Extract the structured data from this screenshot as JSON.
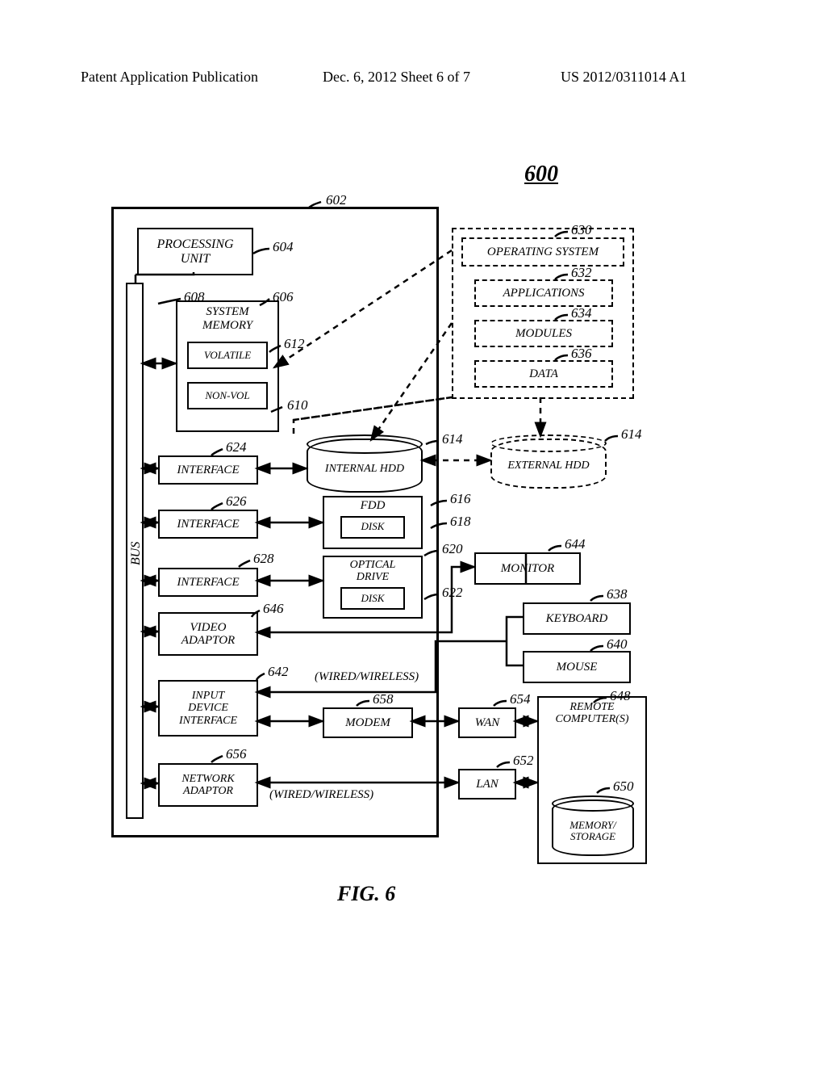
{
  "header": {
    "left": "Patent Application Publication",
    "mid": "Dec. 6, 2012   Sheet 6 of 7",
    "right": "US 2012/0311014 A1"
  },
  "figure": {
    "number_label": "600",
    "caption": "FIG. 6"
  },
  "boxes": {
    "processing_unit": "PROCESSING\nUNIT",
    "system_memory": "SYSTEM\nMEMORY",
    "volatile": "VOLATILE",
    "nonvol": "NON-VOL",
    "interface1": "INTERFACE",
    "interface2": "INTERFACE",
    "interface3": "INTERFACE",
    "video_adaptor": "VIDEO\nADAPTOR",
    "input_device_interface": "INPUT\nDEVICE\nINTERFACE",
    "network_adaptor": "NETWORK\nADAPTOR",
    "internal_hdd": "INTERNAL HDD",
    "external_hdd": "EXTERNAL HDD",
    "fdd": "FDD",
    "fdd_disk": "DISK",
    "optical_drive": "OPTICAL\nDRIVE",
    "optical_disk": "DISK",
    "monitor": "MONITOR",
    "keyboard": "KEYBOARD",
    "mouse": "MOUSE",
    "modem": "MODEM",
    "wan": "WAN",
    "lan": "LAN",
    "remote_computers": "REMOTE\nCOMPUTER(S)",
    "memory_storage": "MEMORY/\nSTORAGE",
    "operating_system": "OPERATING SYSTEM",
    "applications": "APPLICATIONS",
    "modules": "MODULES",
    "data": "DATA",
    "bus": "BUS"
  },
  "annotations": {
    "wired_wireless1": "(WIRED/WIRELESS)",
    "wired_wireless2": "(WIRED/WIRELESS)"
  },
  "refs": {
    "r600": "600",
    "r602": "602",
    "r604": "604",
    "r606": "606",
    "r608": "608",
    "r610": "610",
    "r612": "612",
    "r614a": "614",
    "r614b": "614",
    "r616": "616",
    "r618": "618",
    "r620": "620",
    "r622": "622",
    "r624": "624",
    "r626": "626",
    "r628": "628",
    "r630": "630",
    "r632": "632",
    "r634": "634",
    "r636": "636",
    "r638": "638",
    "r640": "640",
    "r642": "642",
    "r644": "644",
    "r646": "646",
    "r648": "648",
    "r650": "650",
    "r652": "652",
    "r654": "654",
    "r656": "656",
    "r658": "658"
  }
}
